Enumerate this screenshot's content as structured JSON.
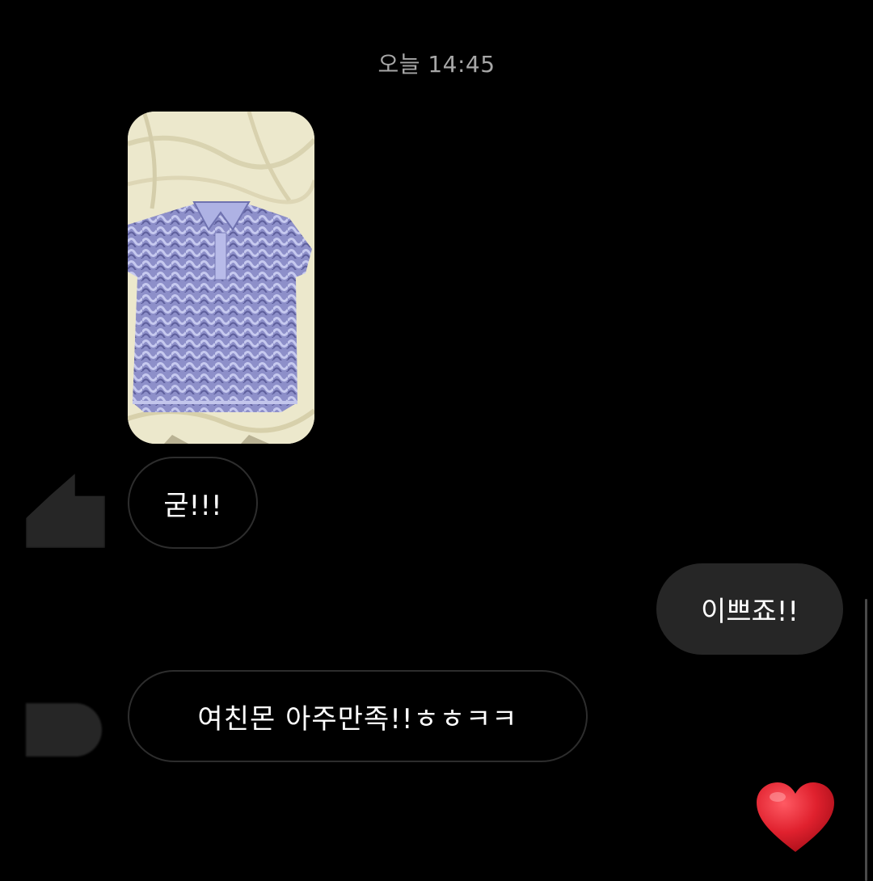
{
  "conversation": {
    "timestamp": "오늘 14:45",
    "messages": [
      {
        "sender": "other",
        "type": "image",
        "image": "purple-knit-polo-shirt-photo"
      },
      {
        "sender": "other",
        "type": "text",
        "text": "굳!!!"
      },
      {
        "sender": "me",
        "type": "text",
        "text": "이쁘죠!!"
      },
      {
        "sender": "other",
        "type": "text",
        "text": "여친몬 아주만족!!ㅎㅎㅋㅋ"
      },
      {
        "sender": "me",
        "type": "emoji",
        "emoji": "heart"
      }
    ]
  },
  "colors": {
    "background": "#000000",
    "incoming_border": "#2d2d2d",
    "outgoing_fill": "#262626",
    "text": "#ffffff",
    "timestamp": "#a7a7a7",
    "heart": "#e0212e"
  },
  "icons": {
    "avatar": "blurred-avatar",
    "reaction": "heart-icon"
  }
}
